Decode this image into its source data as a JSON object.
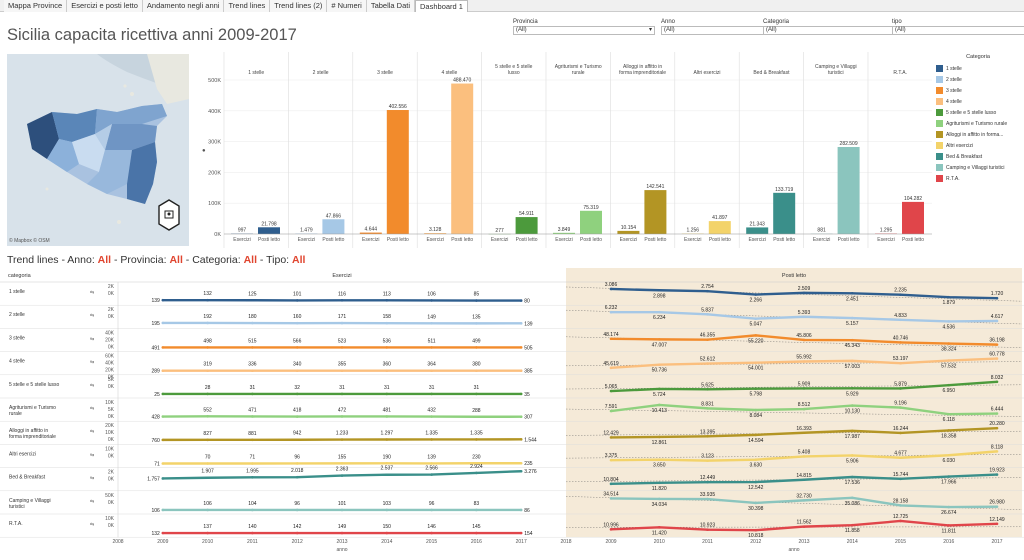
{
  "tabs": [
    "Mappa Province",
    "Esercizi e posti letto",
    "Andamento negli anni",
    "Trend lines",
    "Trend lines (2)",
    "# Numeri",
    "Tabella Dati",
    "Dashboard 1"
  ],
  "active_tab": "Dashboard 1",
  "title": "Sicilia capacita ricettiva anni 2009-2017",
  "filters": [
    {
      "label": "Provincia",
      "value": "(All)"
    },
    {
      "label": "Anno",
      "value": "(All)"
    },
    {
      "label": "Categoria",
      "value": "(All)"
    },
    {
      "label": "tipo",
      "value": "(All)"
    }
  ],
  "map": {
    "attribution": "© Mapbox © OSM"
  },
  "legend": {
    "title": "Categoria"
  },
  "colors": {
    "1 stelle": "#2f5e8e",
    "2 stelle": "#a6c8e6",
    "3 stelle": "#f28b2c",
    "4 stelle": "#fbbf7e",
    "5 stelle e 5 stelle lusso": "#4c9a3c",
    "Agriturismi e Turismo rurale": "#8fd17e",
    "Alloggi in affitto in forma imprenditoriale": "#b39524",
    "Altri esercizi": "#f3d36a",
    "Bed & Breakfast": "#3a8f8a",
    "Camping e Villaggi turistici": "#8bc5be",
    "R.T.A.": "#e0454a"
  },
  "chart_data": [
    {
      "type": "bar",
      "title": "",
      "categories": [
        "1 stelle",
        "2 stelle",
        "3 stelle",
        "4 stelle",
        "5 stelle e 5 stelle lusso",
        "Agriturismi e Turismo rurale",
        "Alloggi in affitto in forma imprenditoriale",
        "Altri esercizi",
        "Bed & Breakfast",
        "Camping e Villaggi turistici",
        "R.T.A."
      ],
      "bar_labels": [
        "Esercizi",
        "Posti letto"
      ],
      "series": [
        {
          "name": "Esercizi",
          "values": [
            997,
            1479,
            4644,
            3128,
            277,
            3849,
            10154,
            1256,
            21343,
            881,
            1295
          ],
          "labels": [
            "997",
            "1.479",
            "4.644",
            "3.128",
            "277",
            "3.849",
            "10.154",
            "1.256",
            "21.343",
            "881",
            "1.295"
          ]
        },
        {
          "name": "Posti letto",
          "values": [
            21798,
            47866,
            402556,
            488470,
            54911,
            75319,
            142541,
            41897,
            133719,
            282509,
            104282
          ],
          "labels": [
            "21.798",
            "47.866",
            "402.556",
            "488.470",
            "54.911",
            "75.319",
            "142.541",
            "41.897",
            "133.719",
            "282.509",
            "104.282"
          ]
        }
      ],
      "category_headers": [
        "1 stelle",
        "2 stelle",
        "3 stelle",
        "4 stelle",
        "5 stelle e 5 stelle lusso",
        "Agriturismi e Turismo rurale",
        "Alloggi in affitto in forma imprenditoriale",
        "Altri esercizi",
        "Bed & Breakfast",
        "Camping e Villaggi turistici",
        "R.T.A."
      ],
      "ylim": [
        0,
        500000
      ],
      "y_ticks": [
        "0K",
        "100K",
        "200K",
        "300K",
        "400K",
        "500K"
      ],
      "grid": true
    },
    {
      "type": "line",
      "title_parts": [
        "Trend lines - Anno: ",
        "All",
        " - Provincia: ",
        "All",
        " - Categoria: ",
        "All",
        " - Tipo: ",
        "All"
      ],
      "row_header": "categoria",
      "panel_titles": [
        "Esercizi",
        "Posti letto"
      ],
      "x_ticks": [
        "2008",
        "2009",
        "2010",
        "2011",
        "2012",
        "2013",
        "2014",
        "2015",
        "2016",
        "2017",
        "2018"
      ],
      "x_ticks_right": [
        "2009",
        "2010",
        "2011",
        "2012",
        "2013",
        "2014",
        "2015",
        "2016",
        "2017"
      ],
      "xlabel": "anno",
      "years": [
        2009,
        2010,
        2011,
        2012,
        2013,
        2014,
        2015,
        2016,
        2017
      ],
      "rows": [
        {
          "name": "1 stelle",
          "y_ticks": [
            "2K",
            "0K"
          ],
          "ymax": 2000,
          "esercizi": [
            139,
            132,
            125,
            101,
            116,
            113,
            106,
            85,
            80
          ],
          "esercizi_labels": [
            "139",
            "132",
            "125",
            "101",
            "116",
            "113",
            "106",
            "85",
            "80"
          ],
          "posti": [
            3086,
            2898,
            2754,
            2266,
            2509,
            2451,
            2235,
            1879,
            1720
          ],
          "posti_labels": [
            "3.086",
            "2.898",
            "2.754",
            "2.266",
            "2.509",
            "2.451",
            "2.235",
            "1.879",
            "1.720"
          ]
        },
        {
          "name": "2 stelle",
          "y_ticks": [
            "2K",
            "0K"
          ],
          "ymax": 2000,
          "esercizi": [
            195,
            192,
            180,
            160,
            171,
            158,
            149,
            135,
            139
          ],
          "esercizi_labels": [
            "195",
            "192",
            "180",
            "160",
            "171",
            "158",
            "149",
            "135",
            "139"
          ],
          "posti": [
            6232,
            6234,
            5837,
            5047,
            5393,
            5157,
            4833,
            4536,
            4617
          ],
          "posti_labels": [
            "6.232",
            "6.234",
            "5.837",
            "5.047",
            "5.393",
            "5.157",
            "4.833",
            "4.536",
            "4.617"
          ]
        },
        {
          "name": "3 stelle",
          "y_ticks": [
            "40K",
            "20K",
            "0K"
          ],
          "ymax": 45000,
          "esercizi": [
            491,
            498,
            515,
            566,
            523,
            536,
            511,
            499,
            505
          ],
          "esercizi_labels": [
            "491",
            "498",
            "515",
            "566",
            "523",
            "536",
            "511",
            "499",
            "505"
          ],
          "posti": [
            48174,
            47007,
            46355,
            55220,
            45806,
            45343,
            40746,
            38324,
            36198
          ],
          "posti_labels": [
            "48.174",
            "47.007",
            "46.355",
            "55.220",
            "45.806",
            "45.343",
            "40.746",
            "38.324",
            "36.198"
          ]
        },
        {
          "name": "4 stelle",
          "y_ticks": [
            "60K",
            "40K",
            "20K",
            "0K"
          ],
          "ymax": 65000,
          "esercizi": [
            289,
            319,
            336,
            340,
            355,
            360,
            364,
            380,
            385
          ],
          "esercizi_labels": [
            "289",
            "319",
            "336",
            "340",
            "355",
            "360",
            "364",
            "380",
            "385"
          ],
          "posti": [
            45619,
            50736,
            52612,
            54001,
            55992,
            57003,
            53197,
            57532,
            60778
          ],
          "posti_labels": [
            "45.619",
            "50.736",
            "52.612",
            "54.001",
            "55.992",
            "57.003",
            "53.197",
            "57.532",
            "60.778"
          ]
        },
        {
          "name": "5 stelle e 5 stelle lusso",
          "y_ticks": [
            "5K",
            "0K"
          ],
          "ymax": 6000,
          "esercizi": [
            25,
            28,
            31,
            32,
            31,
            31,
            31,
            31,
            35
          ],
          "esercizi_labels": [
            "25",
            "28",
            "31",
            "32",
            "31",
            "31",
            "31",
            "31",
            "35"
          ],
          "posti": [
            5065,
            5724,
            5625,
            5798,
            5909,
            5929,
            5879,
            6950,
            8032
          ],
          "posti_labels": [
            "5.065",
            "5.724",
            "5.625",
            "5.798",
            "5.909",
            "5.929",
            "5.879",
            "6.950",
            "8.032"
          ]
        },
        {
          "name": "Agriturismi e Turismo rurale",
          "y_ticks": [
            "10K",
            "5K",
            "0K"
          ],
          "ymax": 10000,
          "esercizi": [
            428,
            552,
            471,
            418,
            472,
            481,
            432,
            288,
            307
          ],
          "esercizi_labels": [
            "428",
            "552",
            "471",
            "418",
            "472",
            "481",
            "432",
            "288",
            "307"
          ],
          "posti": [
            7591,
            10413,
            8831,
            8084,
            8512,
            10130,
            9196,
            6118,
            6444
          ],
          "posti_labels": [
            "7.591",
            "10.413",
            "8.831",
            "8.084",
            "8.512",
            "10.130",
            "9.196",
            "6.118",
            "6.444"
          ]
        },
        {
          "name": "Alloggi in affitto in forma imprenditoriale",
          "y_ticks": [
            "20K",
            "10K",
            "0K"
          ],
          "ymax": 22000,
          "esercizi": [
            760,
            827,
            881,
            942,
            1233,
            1297,
            1335,
            1335,
            1544
          ],
          "esercizi_labels": [
            "760",
            "827",
            "881",
            "942",
            "1.233",
            "1.297",
            "1.335",
            "1.335",
            "1.544"
          ],
          "posti": [
            12429,
            12861,
            13395,
            14594,
            16393,
            17987,
            16244,
            18358,
            20280
          ],
          "posti_labels": [
            "12.429",
            "12.861",
            "13.395",
            "14.594",
            "16.393",
            "17.987",
            "16.244",
            "18.358",
            "20.280"
          ]
        },
        {
          "name": "Altri esercizi",
          "y_ticks": [
            "10K",
            "0K"
          ],
          "ymax": 10000,
          "esercizi": [
            71,
            70,
            71,
            96,
            155,
            190,
            139,
            230,
            235
          ],
          "esercizi_labels": [
            "71",
            "70",
            "71",
            "96",
            "155",
            "190",
            "139",
            "230",
            "235"
          ],
          "posti": [
            3375,
            3650,
            3123,
            3630,
            5408,
            5906,
            4677,
            6030,
            8118
          ],
          "posti_labels": [
            "3.375",
            "3.650",
            "3.123",
            "3.630",
            "5.408",
            "5.906",
            "4.677",
            "6.030",
            "8.118"
          ]
        },
        {
          "name": "Bed & Breakfast",
          "y_ticks": [
            "2K",
            "0K"
          ],
          "ymax": 3200,
          "esercizi": [
            1757,
            1907,
            1995,
            2018,
            2363,
            2537,
            2566,
            2924,
            3276
          ],
          "esercizi_labels": [
            "1.757",
            "1.907",
            "1.995",
            "2.018",
            "2.363",
            "2.537",
            "2.566",
            "2.924",
            "3.276"
          ],
          "posti": [
            10804,
            11820,
            12449,
            12542,
            14815,
            17536,
            15744,
            17966,
            19923
          ],
          "posti_labels": [
            "10.804",
            "11.820",
            "12.449",
            "12.542",
            "14.815",
            "17.536",
            "15.744",
            "17.966",
            "19.923"
          ]
        },
        {
          "name": "Camping e Villaggi turistici",
          "y_ticks": [
            "50K",
            "0K"
          ],
          "ymax": 50000,
          "esercizi": [
            106,
            106,
            104,
            96,
            101,
            103,
            96,
            83,
            86
          ],
          "esercizi_labels": [
            "106",
            "106",
            "104",
            "96",
            "101",
            "103",
            "96",
            "83",
            "86"
          ],
          "posti": [
            34514,
            34034,
            33935,
            30398,
            32730,
            35086,
            28158,
            26674,
            26980
          ],
          "posti_labels": [
            "34.514",
            "34.034",
            "33.935",
            "30.398",
            "32.730",
            "35.086",
            "28.158",
            "26.674",
            "26.980"
          ]
        },
        {
          "name": "R.T.A.",
          "y_ticks": [
            "10K",
            "0K"
          ],
          "ymax": 14000,
          "esercizi": [
            132,
            137,
            140,
            142,
            149,
            150,
            146,
            145,
            154
          ],
          "esercizi_labels": [
            "132",
            "137",
            "140",
            "142",
            "149",
            "150",
            "146",
            "145",
            "154"
          ],
          "posti": [
            10996,
            11420,
            10923,
            10818,
            11562,
            11858,
            12725,
            11811,
            12149
          ],
          "posti_labels": [
            "10.996",
            "11.420",
            "10.923",
            "10.818",
            "11.562",
            "11.858",
            "12.725",
            "11.811",
            "12.149"
          ]
        }
      ]
    }
  ]
}
